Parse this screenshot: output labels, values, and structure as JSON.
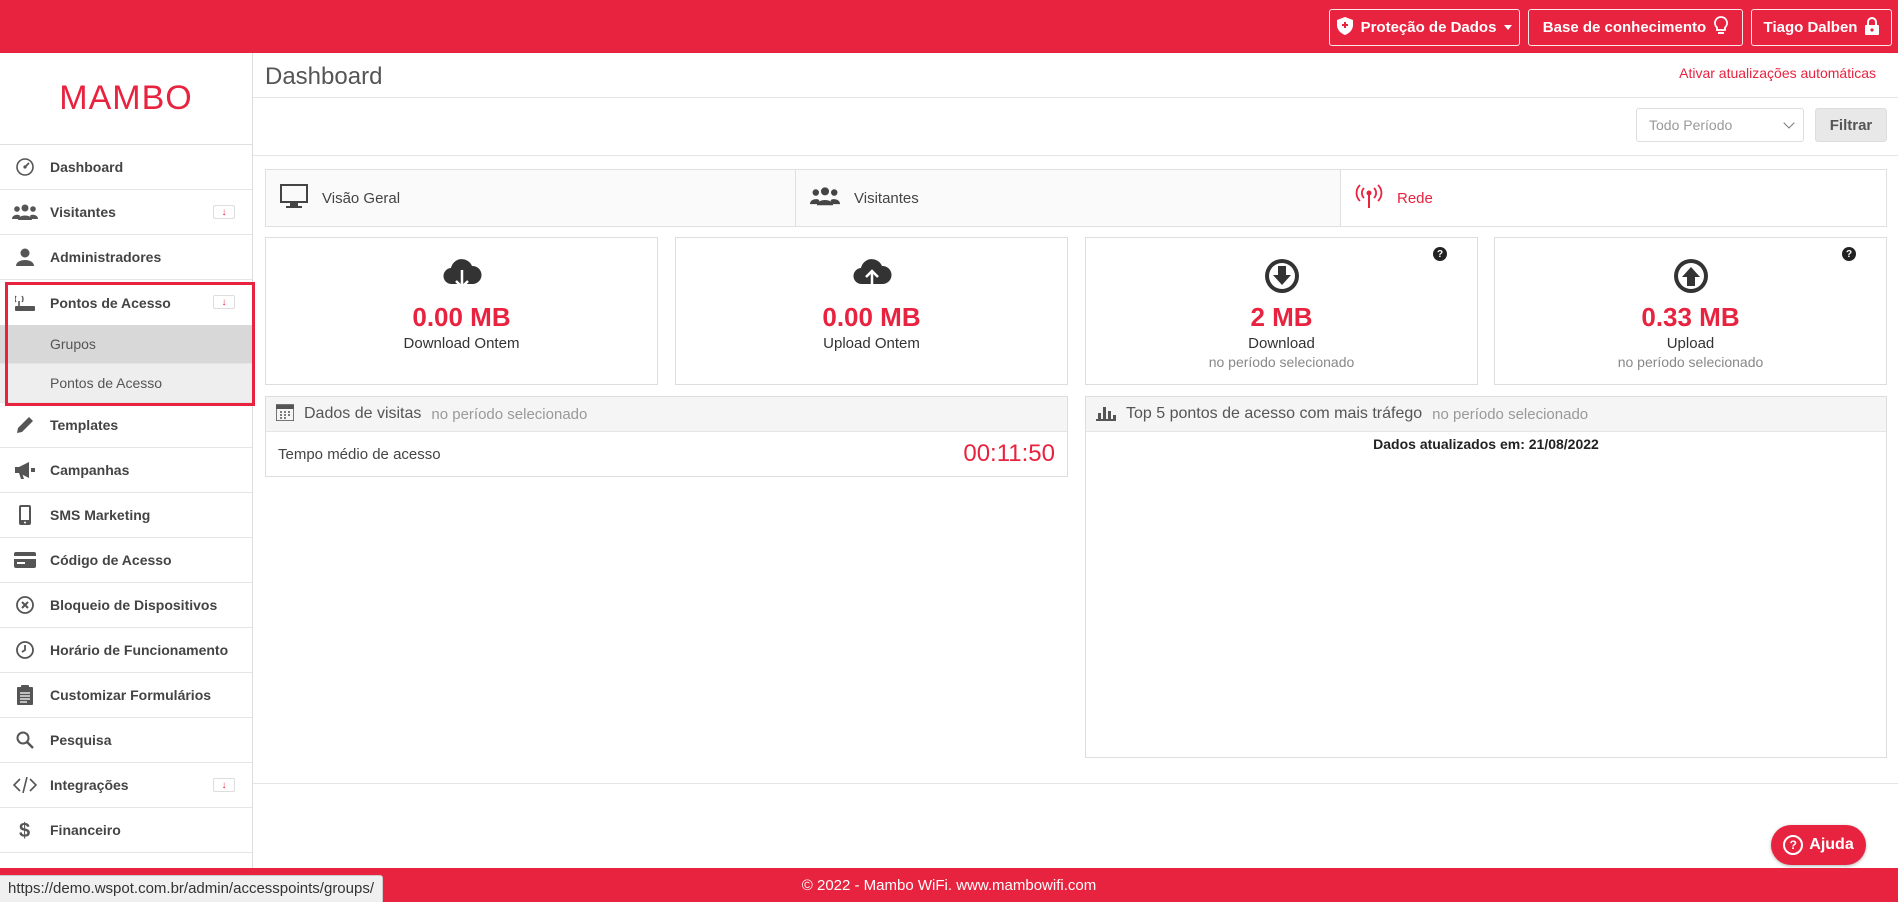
{
  "topbar": {
    "privacy_label": "Proteção de Dados",
    "knowledge_label": "Base de conhecimento",
    "user_label": "Tiago Dalben"
  },
  "logo": {
    "text": "MAMBO"
  },
  "sidebar": {
    "items": [
      {
        "label": "Dashboard",
        "icon": "dashboard-icon"
      },
      {
        "label": "Visitantes",
        "icon": "users-icon",
        "expand": "↓"
      },
      {
        "label": "Administradores",
        "icon": "user-icon"
      },
      {
        "label": "Pontos de Acesso",
        "icon": "router-icon",
        "expand": "↓"
      },
      {
        "label": "Templates",
        "icon": "pencil-icon"
      },
      {
        "label": "Campanhas",
        "icon": "megaphone-icon"
      },
      {
        "label": "SMS Marketing",
        "icon": "phone-icon"
      },
      {
        "label": "Código de Acesso",
        "icon": "card-icon"
      },
      {
        "label": "Bloqueio de Dispositivos",
        "icon": "block-icon"
      },
      {
        "label": "Horário de Funcionamento",
        "icon": "clock-icon"
      },
      {
        "label": "Customizar Formulários",
        "icon": "clipboard-icon"
      },
      {
        "label": "Pesquisa",
        "icon": "search-icon"
      },
      {
        "label": "Integrações",
        "icon": "code-icon",
        "expand": "↓"
      },
      {
        "label": "Financeiro",
        "icon": "dollar-icon"
      }
    ],
    "sub_items": [
      "Grupos",
      "Pontos de Acesso"
    ]
  },
  "header": {
    "title": "Dashboard",
    "auto_update": "Ativar atualizações automáticas"
  },
  "filter": {
    "period_value": "Todo Período",
    "button_label": "Filtrar"
  },
  "tabs": [
    {
      "label": "Visão Geral",
      "icon": "monitor-icon"
    },
    {
      "label": "Visitantes",
      "icon": "users-icon"
    },
    {
      "label": "Rede",
      "icon": "antenna-icon",
      "active": true
    }
  ],
  "stats": [
    {
      "value": "0.00 MB",
      "caption": "Download Ontem",
      "icon": "cloud-download-icon"
    },
    {
      "value": "0.00 MB",
      "caption": "Upload Ontem",
      "icon": "cloud-upload-icon"
    },
    {
      "value": "2 MB",
      "caption": "Download",
      "sub": "no período selecionado",
      "icon": "circle-arrow-down-icon",
      "help": "?"
    },
    {
      "value": "0.33 MB",
      "caption": "Upload",
      "sub": "no período selecionado",
      "icon": "circle-arrow-up-icon",
      "help": "?"
    }
  ],
  "visits_panel": {
    "title": "Dados de visitas",
    "muted": "no período selecionado",
    "row_label": "Tempo médio de acesso",
    "row_value": "00:11:50"
  },
  "traffic_panel": {
    "title": "Top 5 pontos de acesso com mais tráfego",
    "muted": "no período selecionado",
    "updated": "Dados atualizados em: 21/08/2022"
  },
  "footer": {
    "text": "© 2022 - Mambo WiFi. www.mambowifi.com"
  },
  "statusbar": {
    "url": "https://demo.wspot.com.br/admin/accesspoints/groups/"
  },
  "help_button": {
    "label": "Ajuda",
    "glyph": "?"
  },
  "colors": {
    "brand": "#e8233f"
  }
}
